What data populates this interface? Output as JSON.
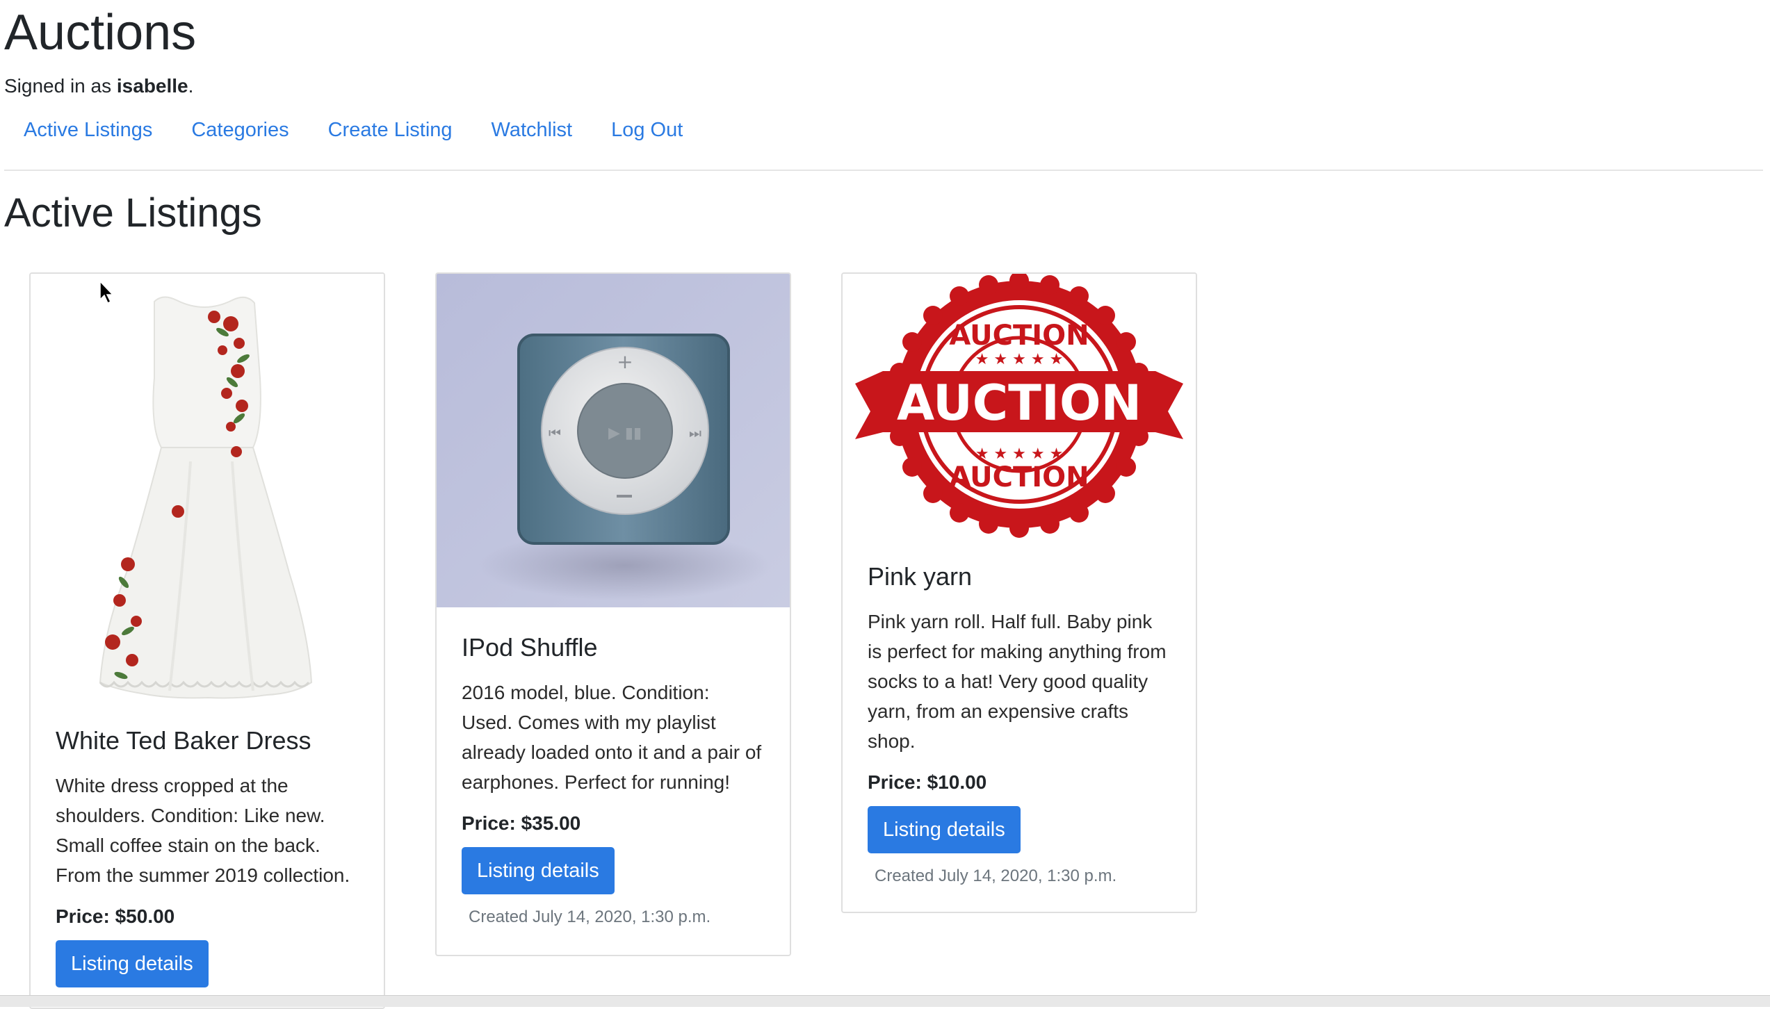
{
  "app": {
    "title": "Auctions",
    "signed_in_prefix": "Signed in as ",
    "username": "isabelle",
    "signed_in_suffix": "."
  },
  "nav": {
    "items": [
      {
        "label": "Active Listings"
      },
      {
        "label": "Categories"
      },
      {
        "label": "Create Listing"
      },
      {
        "label": "Watchlist"
      },
      {
        "label": "Log Out"
      }
    ]
  },
  "main": {
    "heading": "Active Listings",
    "listings": [
      {
        "title": "White Ted Baker Dress",
        "description": "White dress cropped at the shoulders. Condition: Like new. Small coffee stain on the back. From the summer 2019 collection.",
        "price": "Price: $50.00",
        "button_label": "Listing details",
        "image": "white-dress-photo"
      },
      {
        "title": "IPod Shuffle",
        "description": "2016 model, blue. Condition: Used. Comes with my playlist already loaded onto it and a pair of earphones. Perfect for running!",
        "price": "Price: $35.00",
        "button_label": "Listing details",
        "created": "Created July 14, 2020, 1:30 p.m.",
        "image": "ipod-shuffle-photo"
      },
      {
        "title": "Pink yarn",
        "description": "Pink yarn roll. Half full. Baby pink is perfect for making anything from socks to a hat! Very good quality yarn, from an expensive crafts shop.",
        "price": "Price: $10.00",
        "button_label": "Listing details",
        "created": "Created July 14, 2020, 1:30 p.m.",
        "image": "auction-stamp",
        "image_text": "AUCTION"
      }
    ]
  },
  "colors": {
    "link": "#2a7ae2",
    "button_bg": "#2a7ae2",
    "stamp_red": "#c8161b",
    "muted_text": "#6c757d"
  }
}
